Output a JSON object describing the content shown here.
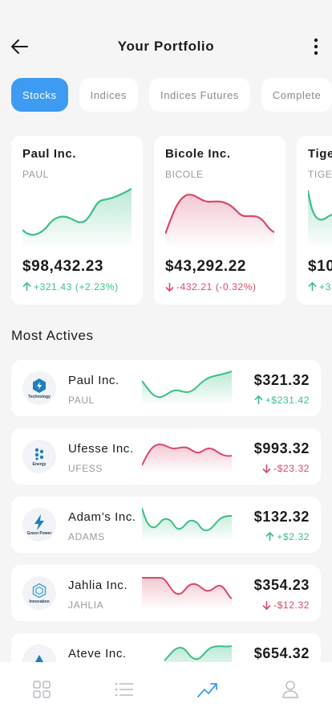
{
  "header": {
    "title": "Your Portfolio"
  },
  "tabs": [
    {
      "label": "Stocks",
      "active": true
    },
    {
      "label": "Indices",
      "active": false
    },
    {
      "label": "Indices Futures",
      "active": false
    },
    {
      "label": "Complete",
      "active": false
    }
  ],
  "portfolio": [
    {
      "name": "Paul Inc.",
      "ticker": "PAUL",
      "price": "$98,432.23",
      "change": "+321.43 (+2.23%)",
      "trend": "up"
    },
    {
      "name": "Bicole Inc.",
      "ticker": "BICOLE",
      "price": "$43,292.22",
      "change": "-432.21 (-0.32%)",
      "trend": "down"
    },
    {
      "name": "Tige",
      "ticker": "TIGE",
      "price": "$10",
      "change": "+3",
      "trend": "up"
    }
  ],
  "most_actives": {
    "title": "Most Actives",
    "items": [
      {
        "name": "Paul Inc.",
        "ticker": "PAUL",
        "price": "$321.32",
        "change": "+$231.42",
        "trend": "up",
        "category": "Technology",
        "icon": "hexagon-bolt-icon"
      },
      {
        "name": "Ufesse Inc.",
        "ticker": "UFESS",
        "price": "$993.32",
        "change": "-$23.32",
        "trend": "down",
        "category": "Energy",
        "icon": "dots-cluster-icon"
      },
      {
        "name": "Adam’s Inc.",
        "ticker": "ADAMS",
        "price": "$132.32",
        "change": "+$2.32",
        "trend": "up",
        "category": "Green Power",
        "icon": "lightning-icon"
      },
      {
        "name": "Jahlia Inc.",
        "ticker": "JAHLIA",
        "price": "$354.23",
        "change": "-$12.32",
        "trend": "down",
        "category": "Innovation",
        "icon": "hexagon-network-icon"
      },
      {
        "name": "Ateve Inc.",
        "ticker": "",
        "price": "$654.32",
        "change": "",
        "trend": "up",
        "category": "",
        "icon": "triangle-icon"
      }
    ]
  },
  "colors": {
    "accent": "#3d9bf2",
    "up": "#3cbf86",
    "down": "#d9496a"
  },
  "nav": [
    "grid-icon",
    "list-icon",
    "trend-chart-icon",
    "user-icon"
  ]
}
